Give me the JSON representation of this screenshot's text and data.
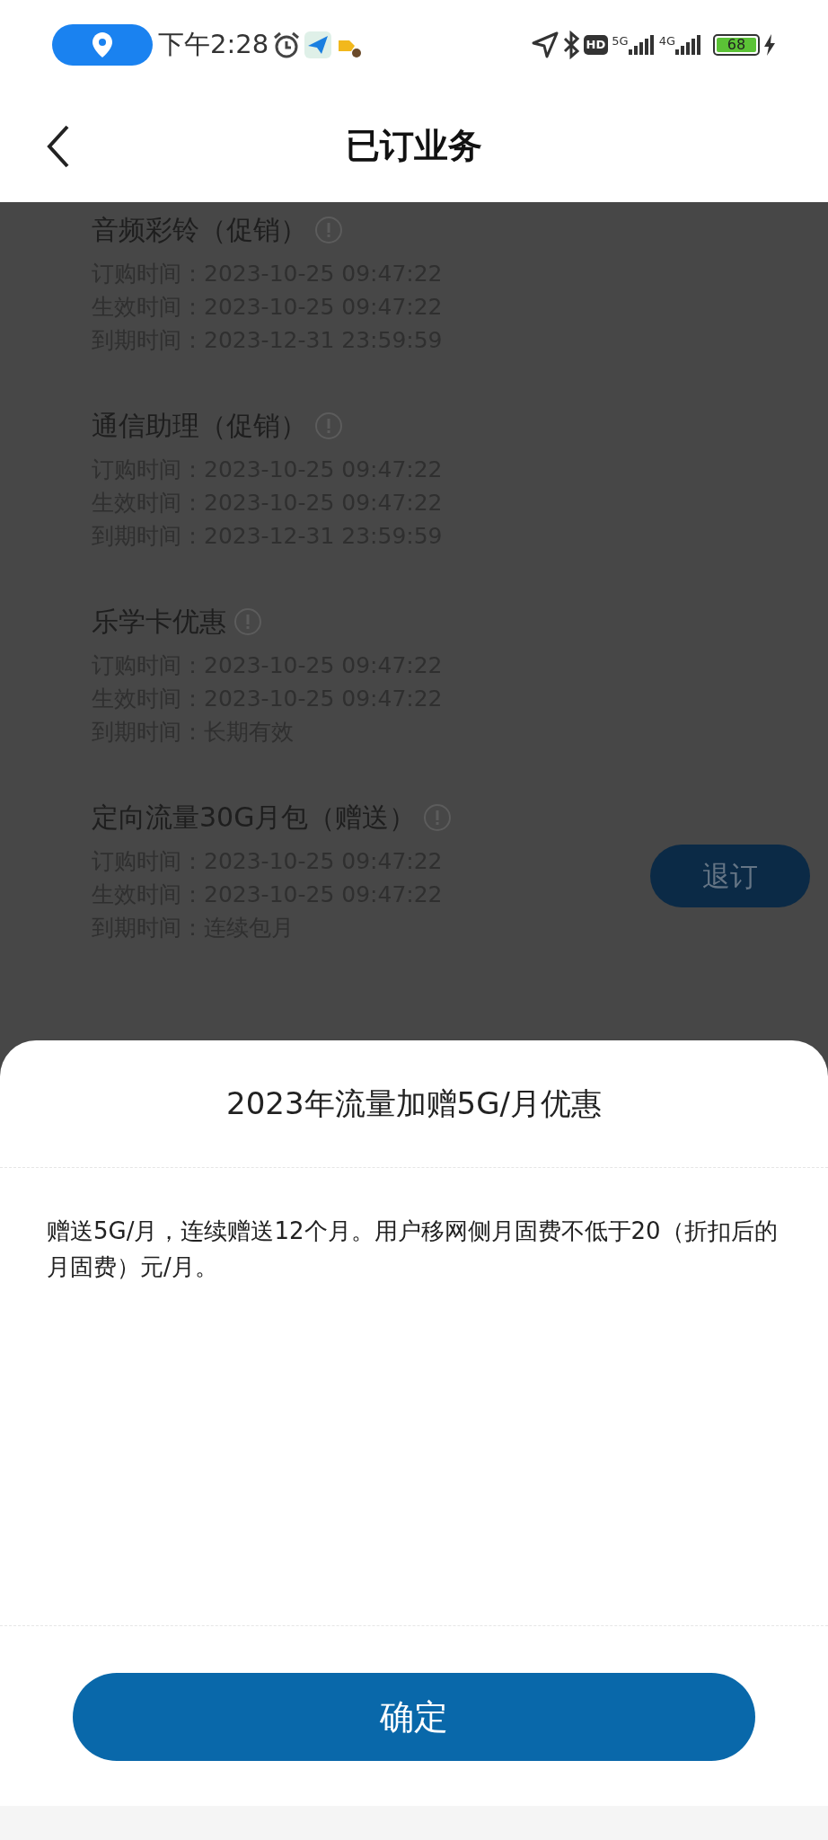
{
  "status_bar": {
    "time": "下午2:28",
    "network_1": "5G",
    "network_2": "4G",
    "battery": "68",
    "hd": "HD"
  },
  "header": {
    "title": "已订业务"
  },
  "services": [
    {
      "title": "音频彩铃（促销）",
      "lines": [
        {
          "label": "订购时间：",
          "value": "2023-10-25 09:47:22"
        },
        {
          "label": "生效时间：",
          "value": "2023-10-25 09:47:22"
        },
        {
          "label": "到期时间：",
          "value": "2023-12-31 23:59:59"
        }
      ]
    },
    {
      "title": "通信助理（促销）",
      "lines": [
        {
          "label": "订购时间：",
          "value": "2023-10-25 09:47:22"
        },
        {
          "label": "生效时间：",
          "value": "2023-10-25 09:47:22"
        },
        {
          "label": "到期时间：",
          "value": "2023-12-31 23:59:59"
        }
      ]
    },
    {
      "title": "乐学卡优惠",
      "lines": [
        {
          "label": "订购时间：",
          "value": "2023-10-25 09:47:22"
        },
        {
          "label": "生效时间：",
          "value": "2023-10-25 09:47:22"
        },
        {
          "label": "到期时间：",
          "value": "长期有效"
        }
      ]
    },
    {
      "title": "定向流量30G月包（赠送）",
      "action": "退订",
      "lines": [
        {
          "label": "订购时间：",
          "value": "2023-10-25 09:47:22"
        },
        {
          "label": "生效时间：",
          "value": "2023-10-25 09:47:22"
        },
        {
          "label": "到期时间：",
          "value": "连续包月"
        }
      ]
    }
  ],
  "sheet": {
    "title": "2023年流量加赠5G/月优惠",
    "body": "赠送5G/月，连续赠送12个月。用户移网侧月固费不低于20（折扣后的月固费）元/月。",
    "confirm": "确定"
  }
}
